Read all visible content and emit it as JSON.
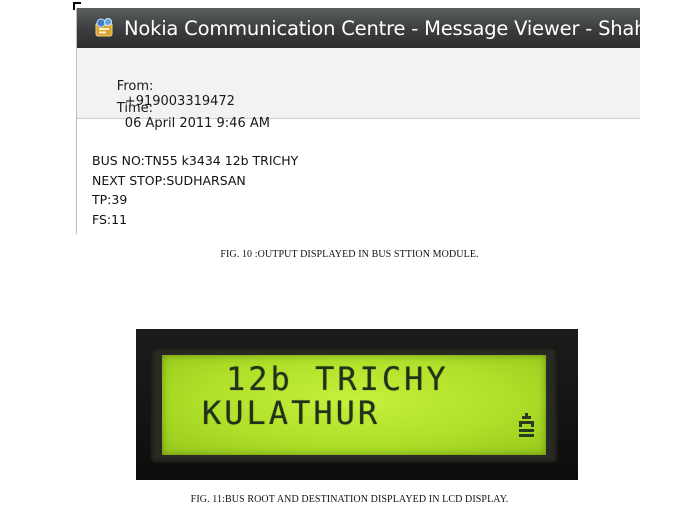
{
  "viewer": {
    "title": "Nokia Communication Centre - Message Viewer - Shahul",
    "from_label": "From:",
    "from_value": "+919003319472",
    "time_label": "Time:",
    "time_value": "06 April 2011 9:46 AM",
    "message_lines": [
      "BUS NO:TN55 k3434 12b TRICHY",
      "NEXT STOP:SUDHARSAN",
      "TP:39",
      "FS:11"
    ]
  },
  "figure10": {
    "caption": "FIG. 10 :OUTPUT DISPLAYED IN BUS STTION MODULE."
  },
  "lcd": {
    "line1": "12b TRICHY",
    "line2": "KULATHUR",
    "screen_color": "#b4e32c",
    "text_color": "#23301a"
  },
  "figure11": {
    "caption": "FIG. 11:BUS ROOT AND DESTINATION DISPLAYED IN LCD DISPLAY."
  }
}
